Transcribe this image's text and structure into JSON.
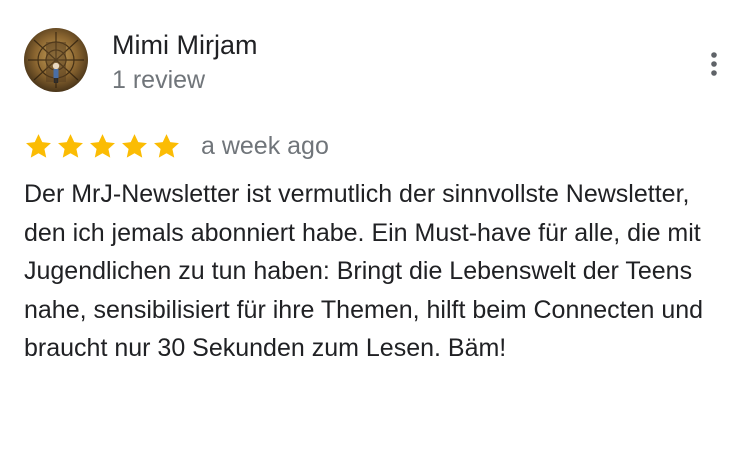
{
  "review": {
    "author_name": "Mimi Mirjam",
    "author_meta": "1 review",
    "rating": 5,
    "rating_max": 5,
    "date": "a week ago",
    "text": "Der MrJ-Newsletter ist vermutlich der sinnvollste Newsletter, den ich jemals abonniert habe. Ein Must-have für alle, die mit Jugendlichen zu tun haben: Bringt die Lebenswelt der Teens nahe, sensibilisiert für ihre Themen, hilft beim Connecten und braucht nur 30 Sekunden zum Lesen. Bäm!"
  },
  "icons": {
    "star": "star-icon",
    "more": "more-vert-icon",
    "avatar": "avatar-image"
  },
  "colors": {
    "star": "#fbbc04",
    "name": "#202124",
    "secondary": "#70757a",
    "icon": "#5f6368"
  }
}
